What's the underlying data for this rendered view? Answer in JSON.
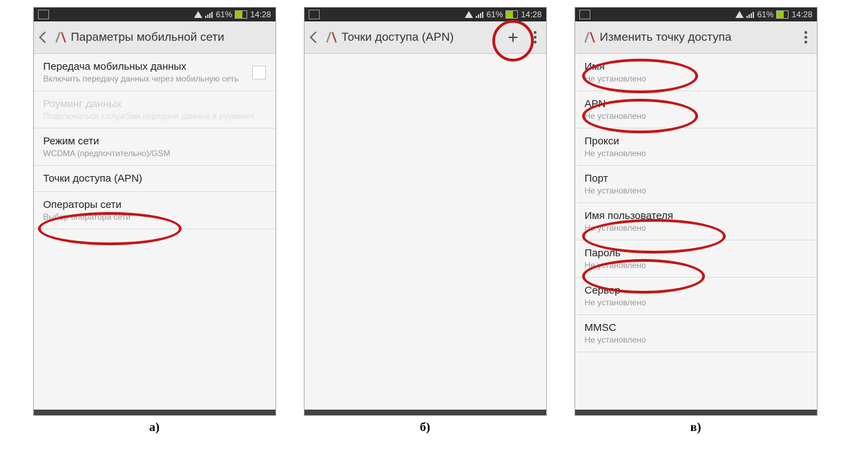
{
  "status": {
    "battery_pct": "61%",
    "time": "14:28"
  },
  "captions": {
    "a": "а)",
    "b": "б)",
    "c": "в)"
  },
  "screenA": {
    "title": "Параметры мобильной сети",
    "items": [
      {
        "title": "Передача мобильных данных",
        "sub": "Включить передачу данных через мобильную сеть",
        "checkbox": true
      },
      {
        "title": "Роуминг данных",
        "sub": "Подключаться к службам передачи данных в роуминге",
        "disabled": true
      },
      {
        "title": "Режим сети",
        "sub": "WCDMA (предпочтительно)/GSM"
      },
      {
        "title": "Точки доступа (APN)",
        "sub": ""
      },
      {
        "title": "Операторы сети",
        "sub": "Выбор оператора сети"
      }
    ]
  },
  "screenB": {
    "title": "Точки доступа (APN)"
  },
  "screenC": {
    "title": "Изменить точку доступа",
    "not_set": "Не установлено",
    "items": [
      {
        "title": "Имя"
      },
      {
        "title": "APN"
      },
      {
        "title": "Прокси"
      },
      {
        "title": "Порт"
      },
      {
        "title": "Имя пользователя"
      },
      {
        "title": "Пароль"
      },
      {
        "title": "Сервер"
      },
      {
        "title": "MMSC"
      }
    ]
  }
}
